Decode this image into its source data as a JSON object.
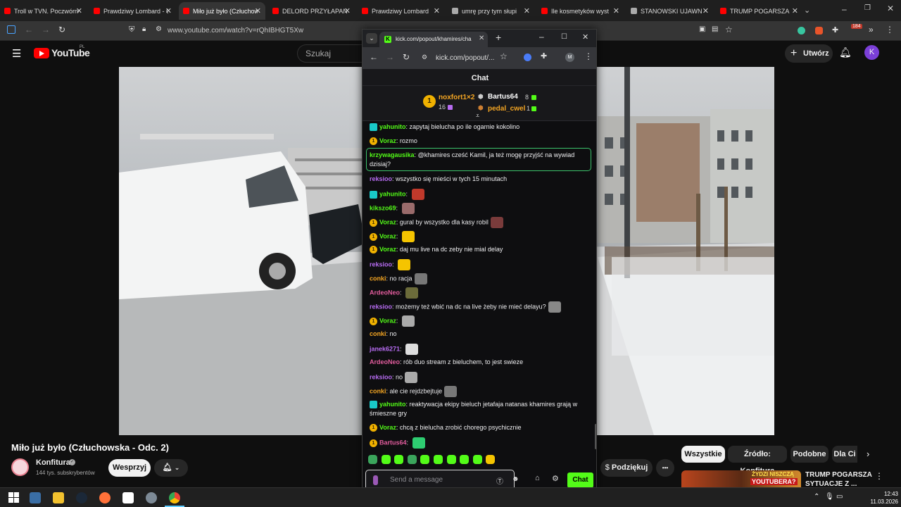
{
  "browser": {
    "tabs": [
      {
        "title": "Troll w TVN. Poczwórne",
        "active": false,
        "favicon_color": "#ff0000"
      },
      {
        "title": "Prawdziwy Lombard - O",
        "active": false,
        "favicon_color": "#ff0000"
      },
      {
        "title": "Miło już było (Człuchow",
        "active": true,
        "favicon_color": "#ff0000"
      },
      {
        "title": "DELORD PRZYŁAPAN",
        "active": false,
        "favicon_color": "#ff0000"
      },
      {
        "title": "Prawdziwy Lombard",
        "active": false,
        "favicon_color": "#ff0000"
      },
      {
        "title": "umrę przy tym słupi",
        "active": false,
        "favicon_color": "#aaaaaa"
      },
      {
        "title": "Ile kosmetyków wyst",
        "active": false,
        "favicon_color": "#ff0000"
      },
      {
        "title": "STANOWSKI UJAWN",
        "active": false,
        "favicon_color": "#aaaaaa"
      },
      {
        "title": "TRUMP POGARSZA",
        "active": false,
        "favicon_color": "#ff0000"
      }
    ],
    "url": "www.youtube.com/watch?v=rQhIBHGT5Xw",
    "extension_badge": "184"
  },
  "youtube": {
    "logo_text": "YouTube",
    "region": "PL",
    "search_placeholder": "Szukaj",
    "create_label": "Utwórz",
    "avatar_letter": "K",
    "video_title": "Miło już było (Człuchowska - Odc. 2)",
    "channel_name": "Konfitura",
    "subscribers": "144 tys. subskrybentów",
    "support_label": "Wesprzyj",
    "thanks_label": "Podziękuj",
    "more_label": "•••",
    "chips": [
      "Wszystkie",
      "Źródło: Konfitura",
      "Podobne",
      "Dla Ci"
    ],
    "rec_title_line1": "TRUMP POGARSZA",
    "rec_title_line2": "SYTUACJE Z ...",
    "rec_thumb_text_line1": "ŻYDZI NISZCZĄ",
    "rec_thumb_text_line2": "YOUTUBERA?"
  },
  "popout": {
    "tab_title": "kick.com/popout/khamires/cha",
    "url": "kick.com/popout/...",
    "profile_letter": "M",
    "chat_header": "Chat",
    "leaderboard": [
      {
        "rank": "1",
        "name": "noxfort1×2",
        "count": "16",
        "color": "#f5a623"
      },
      {
        "name": "Bartus64",
        "count": "8",
        "color": "#ffffff"
      },
      {
        "name": "pedal_cwel",
        "count": "1",
        "color": "#f5a623"
      }
    ],
    "messages": [
      {
        "user": "yahunito",
        "user_color": "#53fc18",
        "badge": "sq",
        "text": "zapytaj bielucha po ile ogarnie kokolino",
        "emote": ""
      },
      {
        "user": "Voraz",
        "user_color": "#53fc18",
        "badge": "gold",
        "text": "rozmo",
        "emote": ""
      },
      {
        "user": "krzywagausika",
        "user_color": "#53fc18",
        "badge": "",
        "text": "@khamires cześć Kamil, ja też mogę przyjść na wywiad dzisiaj?",
        "emote": "",
        "highlight": true
      },
      {
        "user": "reksioo",
        "user_color": "#b76cf2",
        "badge": "",
        "text": "wszystko się mieści w tych 15 minutach",
        "emote": ""
      },
      {
        "user": "yahunito",
        "user_color": "#53fc18",
        "badge": "sq",
        "text": "",
        "emote": "#c0392b"
      },
      {
        "user": "kikszo69",
        "user_color": "#53fc18",
        "badge": "",
        "text": "",
        "emote": "#9a6b6b"
      },
      {
        "user": "Voraz",
        "user_color": "#53fc18",
        "badge": "gold",
        "text": "gural by wszystko dla kasy robil",
        "emote": "#7a3b3b"
      },
      {
        "user": "Voraz",
        "user_color": "#53fc18",
        "badge": "gold",
        "text": "",
        "emote": "#f5c400"
      },
      {
        "user": "Voraz",
        "user_color": "#53fc18",
        "badge": "gold",
        "text": "daj mu live na dc zeby nie mial delay",
        "emote": ""
      },
      {
        "user": "reksioo",
        "user_color": "#b76cf2",
        "badge": "",
        "text": "",
        "emote": "#f5c400"
      },
      {
        "user": "conki",
        "user_color": "#f5a623",
        "badge": "",
        "text": "no racja",
        "emote": "#777777"
      },
      {
        "user": "ArdeoNeo",
        "user_color": "#e05c9c",
        "badge": "",
        "text": "",
        "emote": "#6b6b3a"
      },
      {
        "user": "reksioo",
        "user_color": "#b76cf2",
        "badge": "",
        "text": "możemy też wbić na dc na live żeby nie mieć delayu?",
        "emote": "#888888"
      },
      {
        "user": "Voraz",
        "user_color": "#53fc18",
        "badge": "gold",
        "text": "",
        "emote": "#aaaaaa"
      },
      {
        "user": "conki",
        "user_color": "#f5a623",
        "badge": "",
        "text": "no",
        "emote": ""
      },
      {
        "user": "janek6271",
        "user_color": "#b76cf2",
        "badge": "",
        "text": "",
        "emote": "#dddddd"
      },
      {
        "user": "ArdeoNeo",
        "user_color": "#e05c9c",
        "badge": "",
        "text": "rób duo stream z bieluchem, to jest swieze",
        "emote": ""
      },
      {
        "user": "reksioo",
        "user_color": "#b76cf2",
        "badge": "",
        "text": "no",
        "emote": "#aaaaaa"
      },
      {
        "user": "conki",
        "user_color": "#f5a623",
        "badge": "",
        "text": "ale cie rejdzbejtuje",
        "emote": "#777777"
      },
      {
        "user": "yahunito",
        "user_color": "#53fc18",
        "badge": "sq",
        "text": "reaktywacja ekipy bieluch jetafaja natanas khamires grają w śmieszne gry",
        "emote": ""
      },
      {
        "user": "Voraz",
        "user_color": "#53fc18",
        "badge": "gold",
        "text": "chcą z bielucha zrobić chorego psychicznie",
        "emote": ""
      },
      {
        "user": "Bartus64",
        "user_color": "#e05c9c",
        "badge": "gold",
        "text": "",
        "emote": "#2ecc71"
      }
    ],
    "input_placeholder": "Send a message",
    "send_label": "Chat"
  },
  "taskbar": {
    "time": "12:43",
    "date": "11.03.2026"
  }
}
